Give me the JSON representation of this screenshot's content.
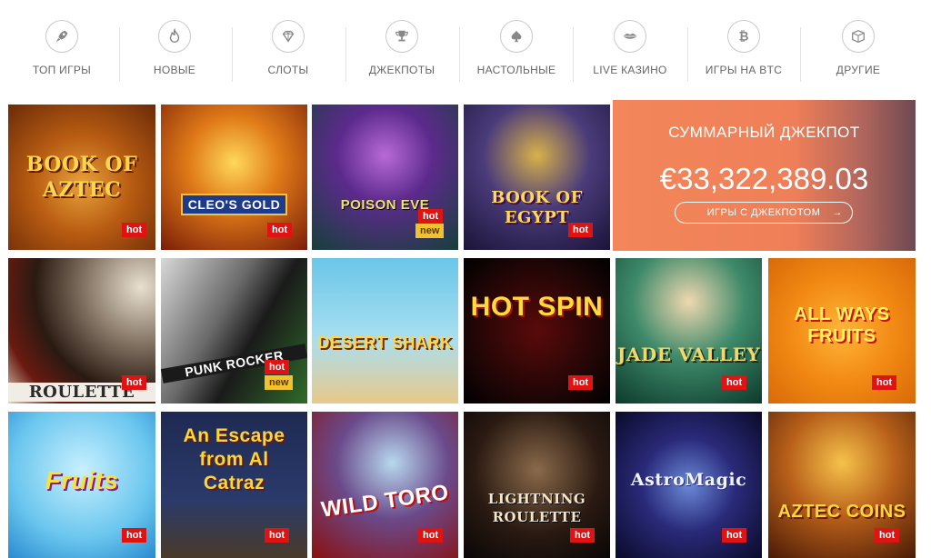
{
  "nav": {
    "items": [
      {
        "label": "ТОП ИГРЫ",
        "icon": "rocket-icon"
      },
      {
        "label": "НОВЫЕ",
        "icon": "flame-icon"
      },
      {
        "label": "СЛОТЫ",
        "icon": "diamond-icon"
      },
      {
        "label": "ДЖЕКПОТЫ",
        "icon": "trophy-icon"
      },
      {
        "label": "НАСТОЛЬНЫЕ",
        "icon": "spade-icon"
      },
      {
        "label": "LIVE КАЗИНО",
        "icon": "lips-icon"
      },
      {
        "label": "ИГРЫ НА BTC",
        "icon": "bitcoin-icon"
      },
      {
        "label": "ДРУГИЕ",
        "icon": "box-icon"
      }
    ]
  },
  "jackpot": {
    "title": "СУММАРНЫЙ ДЖЕКПОТ",
    "amount": "€33,322,389.03",
    "button": "ИГРЫ С ДЖЕКПОТОМ",
    "arrow": "→",
    "accent": "#f3865a"
  },
  "badges": {
    "hot": "hot",
    "new": "new"
  },
  "games": [
    {
      "title": "BOOK OF AZTEC",
      "hot": true,
      "new": false
    },
    {
      "title": "CLEO'S GOLD",
      "hot": true,
      "new": false
    },
    {
      "title": "POISON EVE",
      "hot": true,
      "new": true
    },
    {
      "title": "BOOK OF EGYPT",
      "hot": true,
      "new": false
    },
    {
      "title": "ROULETTE",
      "hot": true,
      "new": false
    },
    {
      "title": "PUNK ROCKER",
      "hot": true,
      "new": true
    },
    {
      "title": "DESERT SHARK",
      "hot": false,
      "new": false
    },
    {
      "title": "HOT SPIN",
      "hot": true,
      "new": false
    },
    {
      "title": "JADE VALLEY",
      "hot": true,
      "new": false
    },
    {
      "title": "ALL WAYS FRUITS",
      "hot": true,
      "new": false
    },
    {
      "title": "Fruits",
      "hot": true,
      "new": false
    },
    {
      "title": "An Escape from Al Catraz",
      "hot": true,
      "new": false
    },
    {
      "title": "WILD TORO",
      "hot": true,
      "new": false
    },
    {
      "title": "LIGHTNING ROULETTE",
      "hot": true,
      "new": false
    },
    {
      "title": "AstroMagic",
      "hot": true,
      "new": false
    },
    {
      "title": "AZTEC COINS",
      "hot": true,
      "new": false
    }
  ]
}
